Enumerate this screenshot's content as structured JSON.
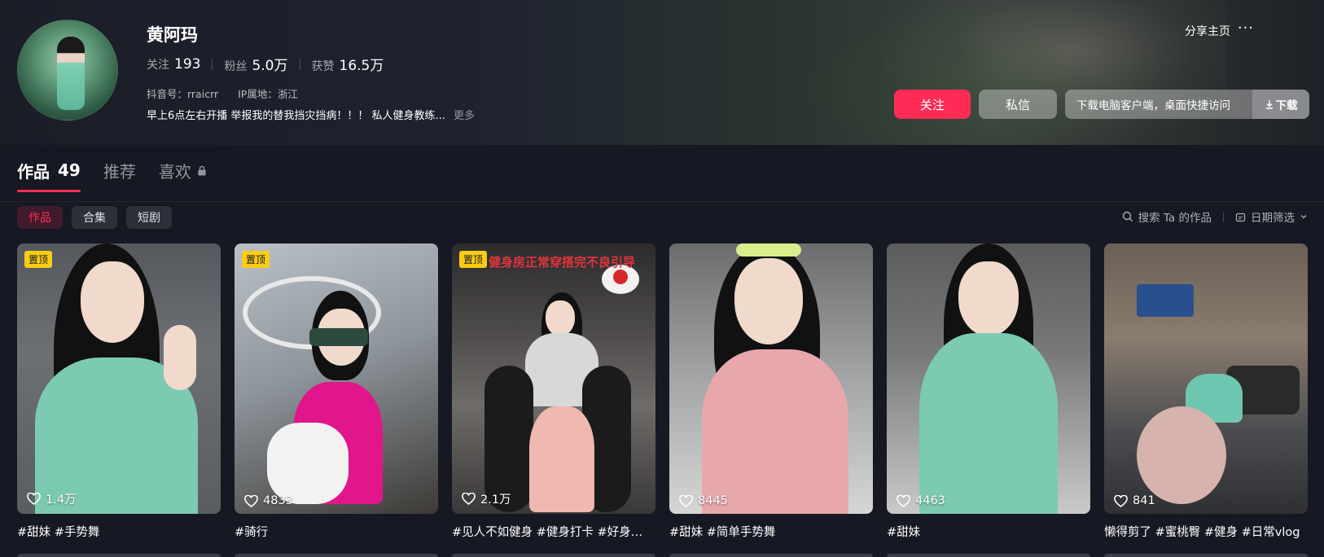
{
  "profile": {
    "name": "黄阿玛",
    "stats": [
      {
        "label": "关注",
        "value": "193"
      },
      {
        "label": "粉丝",
        "value": "5.0万"
      },
      {
        "label": "获赞",
        "value": "16.5万"
      }
    ],
    "douyin_id": "抖音号：rraicrr",
    "ip_location": "IP属地：浙江",
    "bio": "早上6点左右开播 举报我的替我挡灾挡病！！！ 私人健身教练...",
    "bio_more": "更多"
  },
  "header_actions": {
    "share": "分享主页",
    "more": "···",
    "follow": "关注",
    "message": "私信",
    "download_text": "下载电脑客户端，桌面快捷访问",
    "download_button": "下载"
  },
  "tabs": [
    {
      "label": "作品",
      "count": "49"
    },
    {
      "label": "推荐"
    },
    {
      "label": "喜欢"
    }
  ],
  "filters": {
    "chips": [
      "作品",
      "合集",
      "短剧"
    ],
    "search": "搜索 Ta 的作品",
    "date_filter": "日期筛选"
  },
  "pin_label": "置顶",
  "videos": [
    {
      "likes": "1.4万",
      "caption": "#甜妹 #手势舞",
      "pinned": true
    },
    {
      "likes": "4833",
      "caption": "#骑行",
      "pinned": true
    },
    {
      "likes": "2.1万",
      "caption": "#见人不如健身 #健身打卡 #好身…",
      "pinned": true,
      "overlay": "健身房正常穿搭完不良引导"
    },
    {
      "likes": "8445",
      "caption": "#甜妹 #简单手势舞",
      "pinned": false
    },
    {
      "likes": "4463",
      "caption": "#甜妹",
      "pinned": false
    },
    {
      "likes": "841",
      "caption": "懒得剪了 #蜜桃臀 #健身 #日常vlog",
      "pinned": false
    }
  ],
  "colors": {
    "background": "#161823",
    "accent": "#fe2c55",
    "pin_badge": "#facc15"
  }
}
